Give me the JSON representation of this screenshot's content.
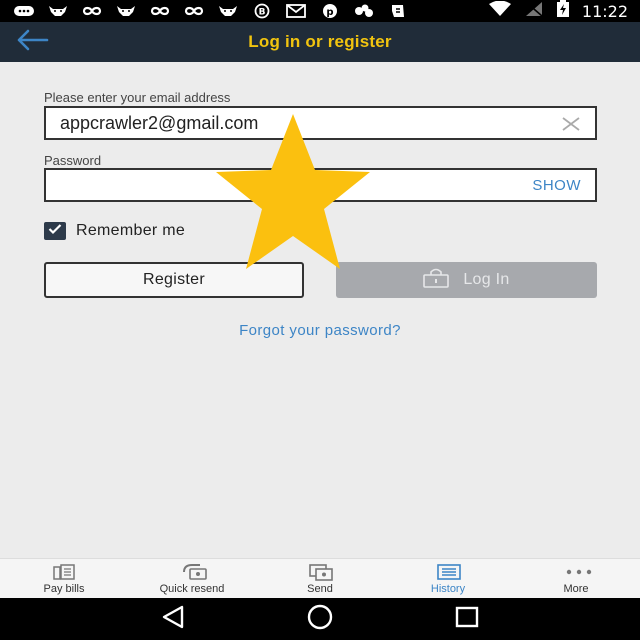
{
  "status_bar": {
    "time": "11:22",
    "notification_icons": [
      "whatsapp-icon",
      "goat-icon",
      "infinity-icon",
      "goat-icon",
      "infinity-icon",
      "infinity-icon",
      "goat-icon",
      "bbm-icon",
      "mail-icon",
      "pinterest-icon",
      "apps-icon",
      "evernote-icon"
    ],
    "system_icons": [
      "wifi-icon",
      "no-signal-icon",
      "battery-charging-icon"
    ]
  },
  "app_bar": {
    "title": "Log in or register",
    "back_icon": "arrow-left-icon"
  },
  "form": {
    "email_label": "Please enter your email address",
    "email_value": "appcrawler2@gmail.com",
    "password_label": "Password",
    "password_value": "",
    "show_label": "SHOW",
    "remember_label": "Remember me",
    "remember_checked": true,
    "register_label": "Register",
    "login_label": "Log In",
    "forgot_label": "Forgot your password?"
  },
  "tabs": [
    {
      "label": "Pay bills",
      "icon": "bills-icon",
      "active": false
    },
    {
      "label": "Quick resend",
      "icon": "resend-icon",
      "active": false
    },
    {
      "label": "Send",
      "icon": "send-money-icon",
      "active": false
    },
    {
      "label": "History",
      "icon": "history-icon",
      "active": true
    },
    {
      "label": "More",
      "icon": "more-dots-icon",
      "active": false
    }
  ],
  "colors": {
    "app_bar": "#202c39",
    "title": "#f1c40f",
    "accent_blue": "#3d85c6",
    "login_disabled": "#a7a9ad",
    "star": "#fbc00f"
  }
}
